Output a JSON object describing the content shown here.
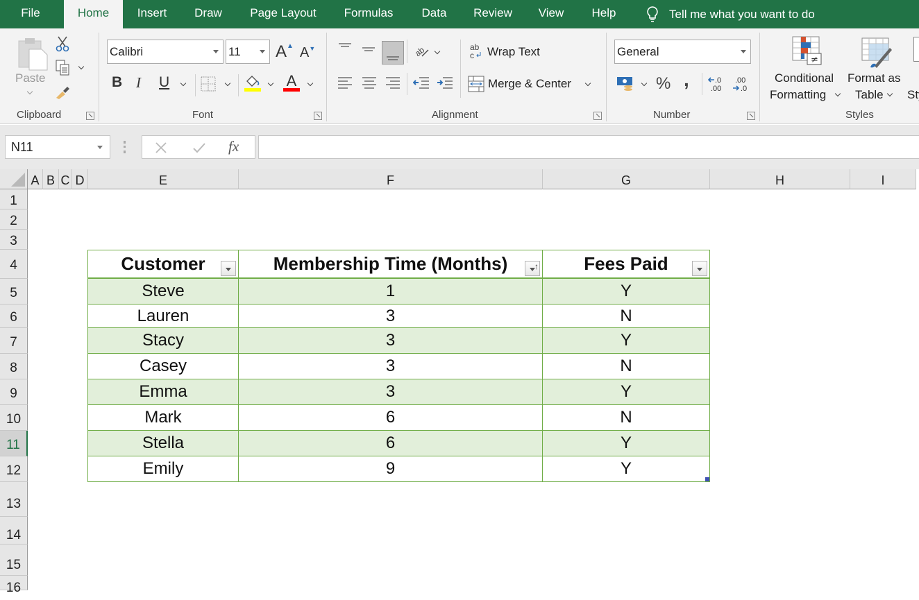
{
  "tabs": [
    {
      "label": "File",
      "active": false
    },
    {
      "label": "Home",
      "active": true
    },
    {
      "label": "Insert",
      "active": false
    },
    {
      "label": "Draw",
      "active": false
    },
    {
      "label": "Page Layout",
      "active": false
    },
    {
      "label": "Formulas",
      "active": false
    },
    {
      "label": "Data",
      "active": false
    },
    {
      "label": "Review",
      "active": false
    },
    {
      "label": "View",
      "active": false
    },
    {
      "label": "Help",
      "active": false
    }
  ],
  "tell_me": "Tell me what you want to do",
  "ribbon": {
    "clipboard": {
      "label": "Clipboard",
      "paste": "Paste"
    },
    "font": {
      "label": "Font",
      "font_name": "Calibri",
      "font_size": "11",
      "bold": "B",
      "italic": "I",
      "underline": "U",
      "fill_color": "#ffff00",
      "font_color": "#ff0000"
    },
    "alignment": {
      "label": "Alignment",
      "wrap_text": "Wrap Text",
      "merge_center": "Merge & Center"
    },
    "number": {
      "label": "Number",
      "format": "General",
      "percent": "%",
      "comma": ","
    },
    "styles": {
      "label": "Styles",
      "conditional_formatting_1": "Conditional",
      "conditional_formatting_2": "Formatting",
      "format_as_table_1": "Format as",
      "format_as_table_2": "Table",
      "cell_styles_partial": "Sty"
    }
  },
  "formula_bar": {
    "name_box": "N11",
    "formula": "",
    "fx": "fx"
  },
  "columns": [
    "A",
    "B",
    "C",
    "D",
    "E",
    "F",
    "G",
    "H",
    "I"
  ],
  "rows": [
    "1",
    "2",
    "3",
    "4",
    "5",
    "6",
    "7",
    "8",
    "9",
    "10",
    "11",
    "12",
    "13",
    "14",
    "15",
    "16"
  ],
  "selected_row": "11",
  "table": {
    "headers": [
      "Customer",
      "Membership Time (Months)",
      "Fees Paid"
    ],
    "rows": [
      [
        "Steve",
        "1",
        "Y"
      ],
      [
        "Lauren",
        "3",
        "N"
      ],
      [
        "Stacy",
        "3",
        "Y"
      ],
      [
        "Casey",
        "3",
        "N"
      ],
      [
        "Emma",
        "3",
        "Y"
      ],
      [
        "Mark",
        "6",
        "N"
      ],
      [
        "Stella",
        "6",
        "Y"
      ],
      [
        "Emily",
        "9",
        "Y"
      ]
    ],
    "band_color": "#e2efda",
    "border_color": "#70ad47"
  },
  "theme": {
    "accent": "#217346"
  }
}
